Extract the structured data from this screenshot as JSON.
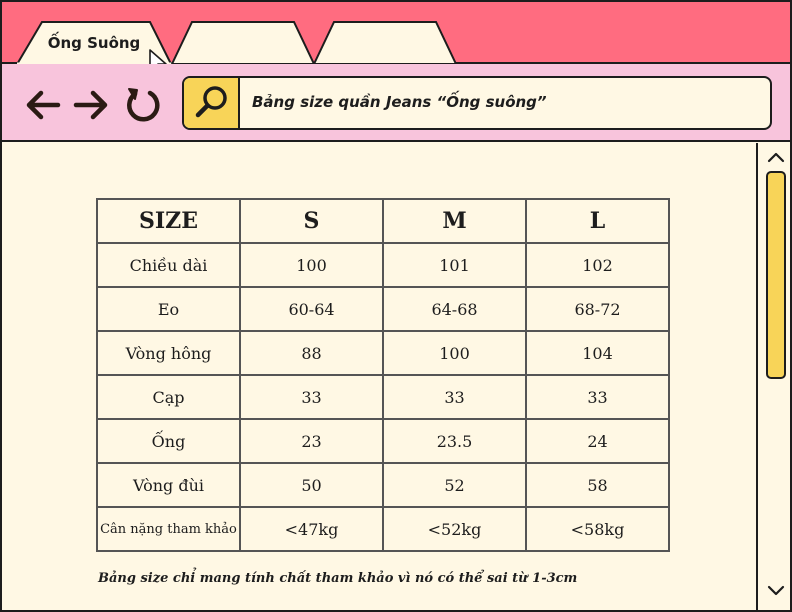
{
  "tabs": [
    {
      "label": "Ống Suông",
      "active": true
    },
    {
      "label": "",
      "active": false
    },
    {
      "label": "",
      "active": false
    }
  ],
  "address_bar": {
    "text": "Bảng size quần Jeans “Ống suông”"
  },
  "icons": {
    "back": "left-arrow-icon",
    "forward": "right-arrow-icon",
    "reload": "reload-icon",
    "search": "magnifier-icon",
    "scroll_up": "chevron-up-icon",
    "scroll_down": "chevron-down-icon"
  },
  "colors": {
    "tabbar": "#ff6c80",
    "navbar": "#f8c4dc",
    "tab": "#fff8e4",
    "accent": "#f8d458",
    "background": "#fff8e4",
    "outline": "#1d1d1d"
  },
  "size_table": {
    "headers": [
      "SIZE",
      "S",
      "M",
      "L"
    ],
    "rows": [
      {
        "label": "Chiều dài",
        "values": [
          "100",
          "101",
          "102"
        ]
      },
      {
        "label": "Eo",
        "values": [
          "60-64",
          "64-68",
          "68-72"
        ]
      },
      {
        "label": "Vòng hông",
        "values": [
          "88",
          "100",
          "104"
        ]
      },
      {
        "label": "Cạp",
        "values": [
          "33",
          "33",
          "33"
        ]
      },
      {
        "label": "Ống",
        "values": [
          "23",
          "23.5",
          "24"
        ]
      },
      {
        "label": "Vòng đùi",
        "values": [
          "50",
          "52",
          "58"
        ]
      },
      {
        "label": "Cân nặng tham khảo",
        "values": [
          "<47kg",
          "<52kg",
          "<58kg"
        ]
      }
    ]
  },
  "note": "Bảng size chỉ mang tính chất tham khảo vì nó có thể sai từ 1-3cm"
}
